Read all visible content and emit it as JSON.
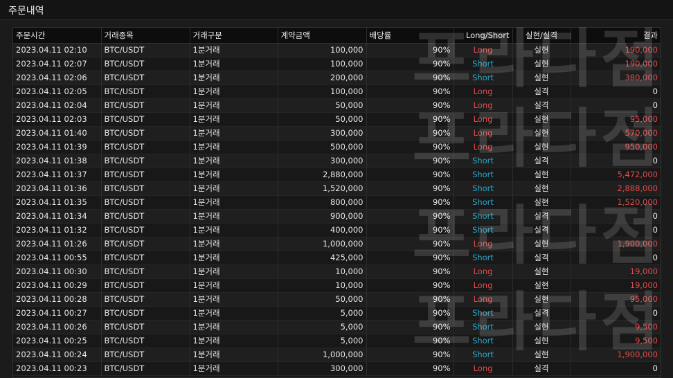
{
  "title": "주문내역",
  "watermark": "프라다점",
  "table": {
    "headers": [
      "주문시간",
      "거래종목",
      "거래구분",
      "계약금액",
      "배당률",
      "Long/Short",
      "실현/실격",
      "결과"
    ],
    "rows": [
      [
        "2023.04.11 02:10",
        "BTC/USDT",
        "1분거래",
        "100,000",
        "90%",
        "Long",
        "실현",
        "190,000"
      ],
      [
        "2023.04.11 02:07",
        "BTC/USDT",
        "1분거래",
        "100,000",
        "90%",
        "Short",
        "실현",
        "190,000"
      ],
      [
        "2023.04.11 02:06",
        "BTC/USDT",
        "1분거래",
        "200,000",
        "90%",
        "Short",
        "실현",
        "380,000"
      ],
      [
        "2023.04.11 02:05",
        "BTC/USDT",
        "1분거래",
        "100,000",
        "90%",
        "Long",
        "실격",
        "0"
      ],
      [
        "2023.04.11 02:04",
        "BTC/USDT",
        "1분거래",
        "50,000",
        "90%",
        "Long",
        "실격",
        "0"
      ],
      [
        "2023.04.11 02:03",
        "BTC/USDT",
        "1분거래",
        "50,000",
        "90%",
        "Long",
        "실현",
        "95,000"
      ],
      [
        "2023.04.11 01:40",
        "BTC/USDT",
        "1분거래",
        "300,000",
        "90%",
        "Long",
        "실현",
        "570,000"
      ],
      [
        "2023.04.11 01:39",
        "BTC/USDT",
        "1분거래",
        "500,000",
        "90%",
        "Long",
        "실현",
        "950,000"
      ],
      [
        "2023.04.11 01:38",
        "BTC/USDT",
        "1분거래",
        "300,000",
        "90%",
        "Short",
        "실격",
        "0"
      ],
      [
        "2023.04.11 01:37",
        "BTC/USDT",
        "1분거래",
        "2,880,000",
        "90%",
        "Short",
        "실현",
        "5,472,000"
      ],
      [
        "2023.04.11 01:36",
        "BTC/USDT",
        "1분거래",
        "1,520,000",
        "90%",
        "Short",
        "실현",
        "2,888,000"
      ],
      [
        "2023.04.11 01:35",
        "BTC/USDT",
        "1분거래",
        "800,000",
        "90%",
        "Short",
        "실현",
        "1,520,000"
      ],
      [
        "2023.04.11 01:34",
        "BTC/USDT",
        "1분거래",
        "900,000",
        "90%",
        "Short",
        "실격",
        "0"
      ],
      [
        "2023.04.11 01:32",
        "BTC/USDT",
        "1분거래",
        "400,000",
        "90%",
        "Short",
        "실격",
        "0"
      ],
      [
        "2023.04.11 01:26",
        "BTC/USDT",
        "1분거래",
        "1,000,000",
        "90%",
        "Long",
        "실현",
        "1,900,000"
      ],
      [
        "2023.04.11 00:55",
        "BTC/USDT",
        "1분거래",
        "425,000",
        "90%",
        "Short",
        "실격",
        "0"
      ],
      [
        "2023.04.11 00:30",
        "BTC/USDT",
        "1분거래",
        "10,000",
        "90%",
        "Long",
        "실현",
        "19,000"
      ],
      [
        "2023.04.11 00:29",
        "BTC/USDT",
        "1분거래",
        "10,000",
        "90%",
        "Long",
        "실현",
        "19,000"
      ],
      [
        "2023.04.11 00:28",
        "BTC/USDT",
        "1분거래",
        "50,000",
        "90%",
        "Long",
        "실현",
        "95,000"
      ],
      [
        "2023.04.11 00:27",
        "BTC/USDT",
        "1분거래",
        "5,000",
        "90%",
        "Short",
        "실격",
        "0"
      ],
      [
        "2023.04.11 00:26",
        "BTC/USDT",
        "1분거래",
        "5,000",
        "90%",
        "Short",
        "실현",
        "9,500"
      ],
      [
        "2023.04.11 00:25",
        "BTC/USDT",
        "1분거래",
        "5,000",
        "90%",
        "Short",
        "실현",
        "9,500"
      ],
      [
        "2023.04.11 00:24",
        "BTC/USDT",
        "1분거래",
        "1,000,000",
        "90%",
        "Short",
        "실현",
        "1,900,000"
      ],
      [
        "2023.04.11 00:23",
        "BTC/USDT",
        "1분거래",
        "300,000",
        "90%",
        "Long",
        "실격",
        "0"
      ]
    ]
  },
  "colors": {
    "long": "#e04b4b",
    "short": "#2aa7c9",
    "profit": "#e04b4b"
  }
}
